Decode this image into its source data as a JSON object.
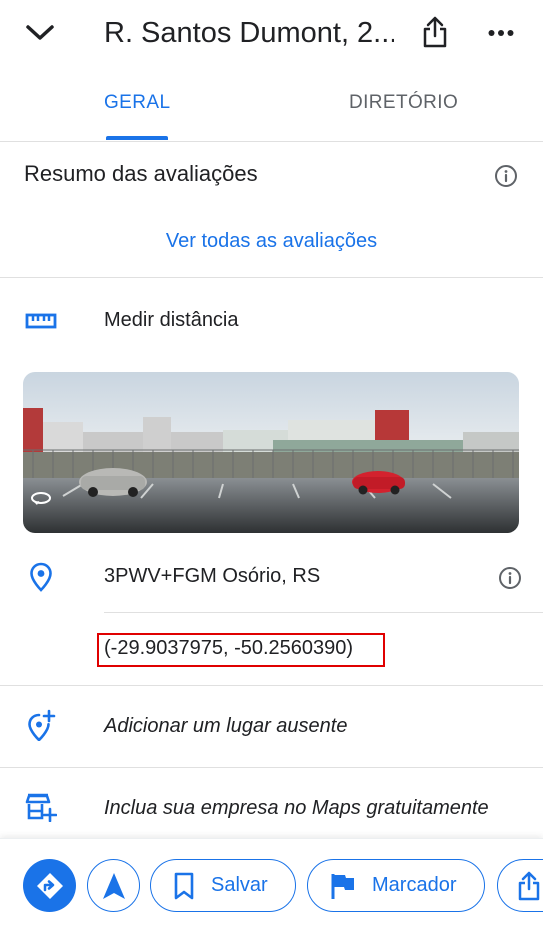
{
  "header": {
    "title": "R. Santos Dumont, 2...",
    "back_icon": "chevron-down-icon",
    "share_icon": "share-icon",
    "more_icon": "more-horizontal-icon"
  },
  "tabs": [
    {
      "label": "GERAL",
      "active": true
    },
    {
      "label": "DIRETÓRIO",
      "active": false
    }
  ],
  "reviews": {
    "title": "Resumo das avaliações",
    "link": "Ver todas as avaliações"
  },
  "measure": {
    "label": "Medir distância",
    "icon": "ruler-icon"
  },
  "place": {
    "plus_code": "3PWV+FGM Osório, RS",
    "coordinates": "(-29.9037975, -50.2560390)",
    "icon": "location-pin-icon"
  },
  "actions": {
    "add_place": "Adicionar um lugar ausente",
    "add_business": "Inclua sua empresa no Maps gratuitamente"
  },
  "bottom_bar": {
    "save_label": "Salvar",
    "label_label": "Marcador"
  },
  "colors": {
    "accent": "#1a73e8",
    "highlight_box": "#e00000"
  }
}
